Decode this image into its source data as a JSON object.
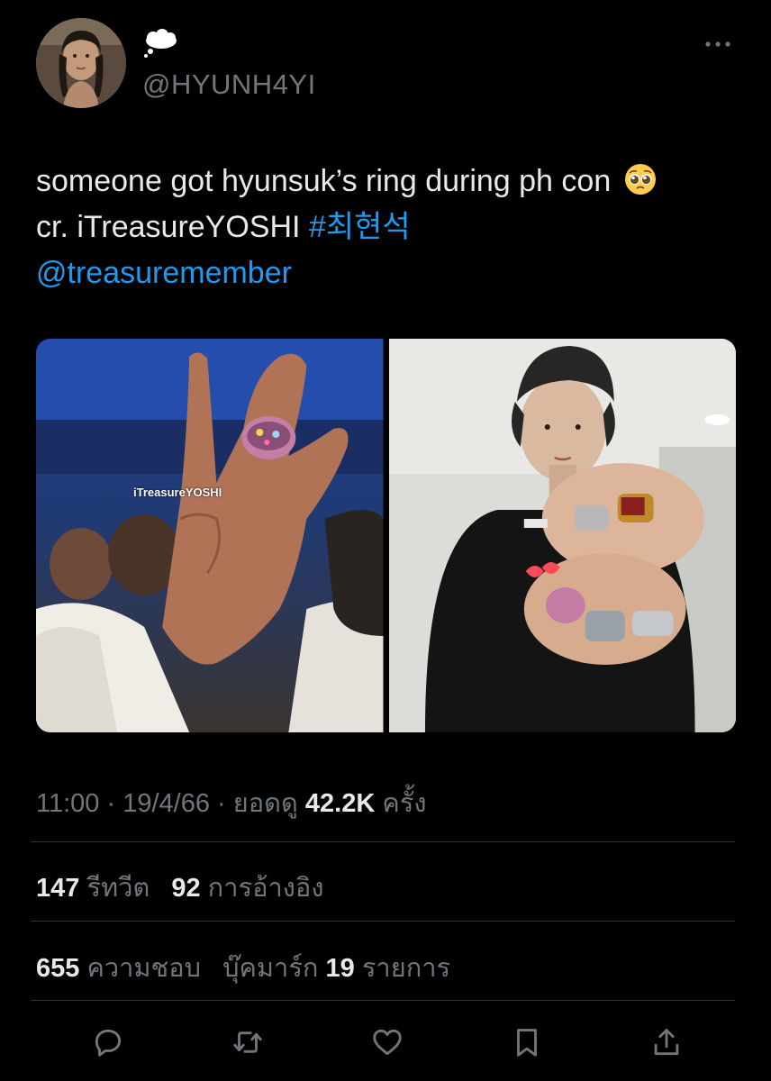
{
  "author": {
    "handle": "@HYUNH4YI",
    "avatar_icon": "profile-avatar",
    "status_icon": "cloud-icon"
  },
  "tweet": {
    "line1": "someone got hyunsuk’s ring during ph con",
    "line1_emoji": "pleading-face-emoji",
    "line2_text": "cr. iTreasureYOSHI",
    "hashtag": "#최현석",
    "mention": "@treasuremember"
  },
  "media": {
    "photo1_watermark": "iTreasureYOSHI"
  },
  "meta": {
    "time": "11:00",
    "date": "19/4/66",
    "views_label": "ยอดดู",
    "views": "42.2K",
    "views_suffix": "ครั้ง"
  },
  "stats": {
    "retweets": "147",
    "retweets_label": "รีทวีต",
    "quotes": "92",
    "quotes_label": "การอ้างอิง",
    "likes": "655",
    "likes_label": "ความชอบ",
    "bookmarks_label": "บุ๊คมาร์ก",
    "bookmarks": "19",
    "bookmarks_suffix": "รายการ"
  },
  "colors": {
    "background": "#000000",
    "text": "#e7e9ea",
    "secondary": "#71767b",
    "link": "#1d9bf0",
    "divider": "#2f3336"
  }
}
